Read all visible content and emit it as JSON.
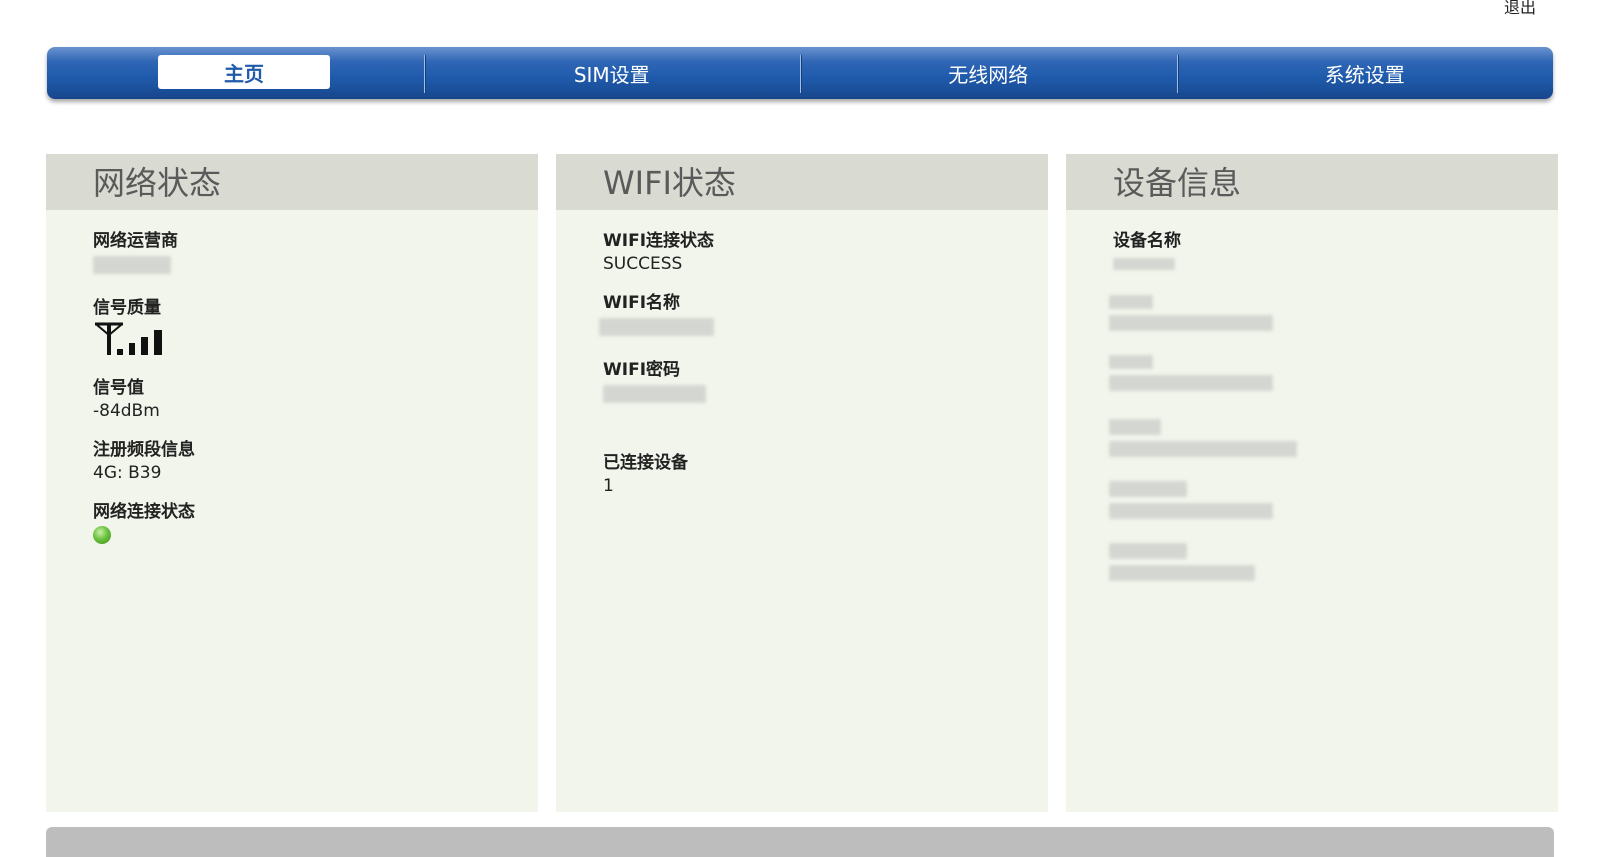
{
  "header": {
    "logout_label": "退出"
  },
  "nav": {
    "tabs": [
      {
        "label": "主页",
        "active": true
      },
      {
        "label": "SIM设置"
      },
      {
        "label": "无线网络"
      },
      {
        "label": "系统设置"
      }
    ]
  },
  "network_status": {
    "title": "网络状态",
    "operator_label": "网络运营商",
    "signal_quality_label": "信号质量",
    "signal_bars": 4,
    "signal_value_label": "信号值",
    "signal_value": "-84dBm",
    "band_label": "注册频段信息",
    "band_value": "4G: B39",
    "connection_label": "网络连接状态",
    "connection_color": "#6cc23f"
  },
  "wifi_status": {
    "title": "WIFI状态",
    "connection_label": "WIFI连接状态",
    "connection_value": "SUCCESS",
    "name_label": "WIFI名称",
    "password_label": "WIFI密码",
    "connected_devices_label": "已连接设备",
    "connected_devices_value": "1"
  },
  "device_info": {
    "title": "设备信息",
    "device_name_label": "设备名称"
  },
  "colors": {
    "nav_blue": "#1f5aab",
    "panel_bg": "#f1f5ec",
    "panel_header_bg": "#d9dbd3"
  }
}
